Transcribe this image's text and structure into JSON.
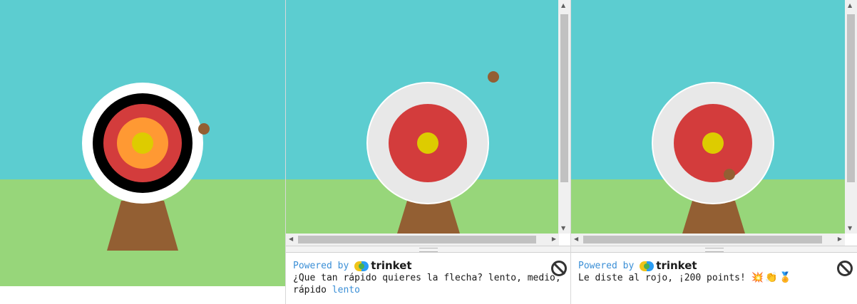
{
  "panels": [
    {
      "id": "panel-1",
      "variant": "full",
      "target_rings": [
        "#ffffff",
        "#000000",
        "#d33c3c",
        "#ff9933",
        "#ddcc00"
      ],
      "arrow_landed": false
    },
    {
      "id": "panel-2",
      "variant": "simple",
      "target_rings": [
        "#e8e8e8",
        "#d33c3c",
        "#ddcc00"
      ],
      "console": {
        "powered_by": "Powered by",
        "logo": "trinket",
        "line1": "¿Que tan rápido quieres la flecha? lento, medio,",
        "line2_prefix": "rápido ",
        "line2_input": "lento"
      }
    },
    {
      "id": "panel-3",
      "variant": "simple",
      "target_rings": [
        "#e8e8e8",
        "#d33c3c",
        "#ddcc00"
      ],
      "console": {
        "powered_by": "Powered by",
        "logo": "trinket",
        "line1": "Le diste al rojo, ¡200 points! ",
        "emojis": "💥👏🏅"
      }
    }
  ],
  "colors": {
    "sky": "#5ccdd0",
    "grass": "#97d67a",
    "stand": "#935f33",
    "arrow": "#935f33",
    "link_blue": "#3b8fd6"
  },
  "icons": [
    "stop-icon",
    "trinket-logo-icon"
  ]
}
